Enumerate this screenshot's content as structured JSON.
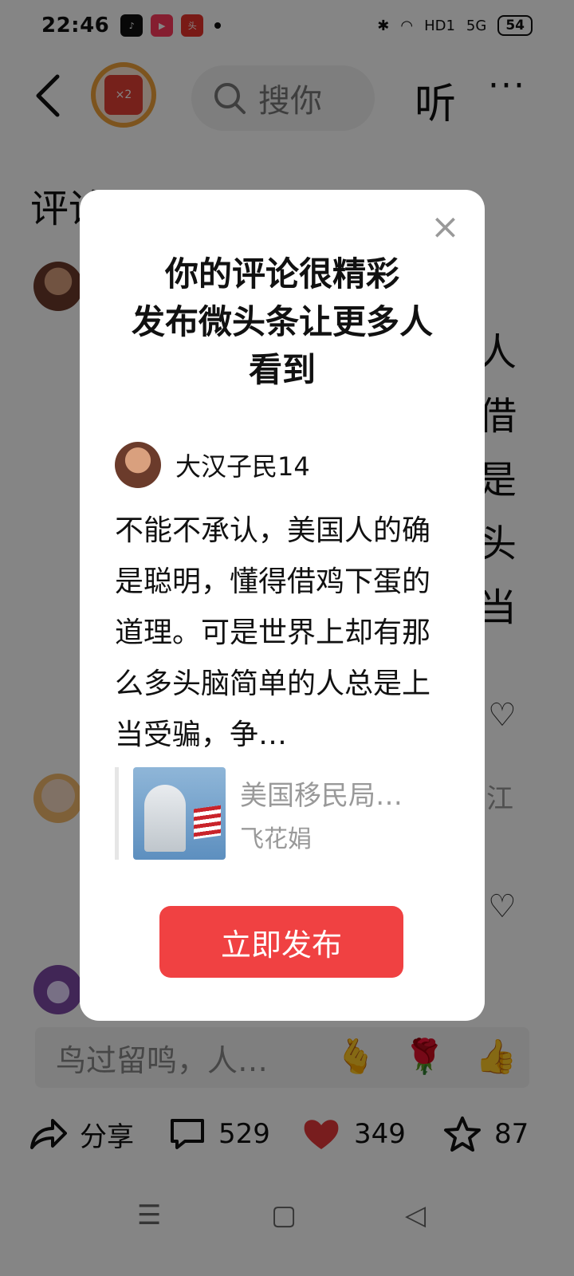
{
  "status_bar": {
    "time": "22:46",
    "network": "5G",
    "battery": "54",
    "hd": "HD1"
  },
  "app_icons": [
    "tiktok-icon",
    "video-icon",
    "toutiao-icon"
  ],
  "top_nav": {
    "search_placeholder": "搜你",
    "listen_label": "听",
    "more_label": "···",
    "badge_label": "×2"
  },
  "comments": {
    "title": "评论 529"
  },
  "background_text": {
    "line1": "人",
    "line2": "借",
    "line3": "是",
    "line4": "头",
    "line5": "当",
    "reply_hint": "鸟过留鸣，人…",
    "side_label": "江"
  },
  "dialog": {
    "title_line1": "你的评论很精彩",
    "title_line2": "发布微头条让更多人",
    "title_line3": "看到",
    "author_name": "大汉子民14",
    "comment_text": "不能不承认，美国人的确是聪明，懂得借鸡下蛋的道理。可是世界上却有那么多头脑简单的人总是上当受骗，争…",
    "quote_title": "美国移民局…",
    "quote_source": "飞花娟",
    "publish_label": "立即发布"
  },
  "bottom_actions": {
    "share": "分享",
    "comments": "529",
    "likes": "349",
    "favorites": "87"
  },
  "colors": {
    "accent": "#f04142",
    "overlay": "rgba(0,0,0,0.48)"
  }
}
